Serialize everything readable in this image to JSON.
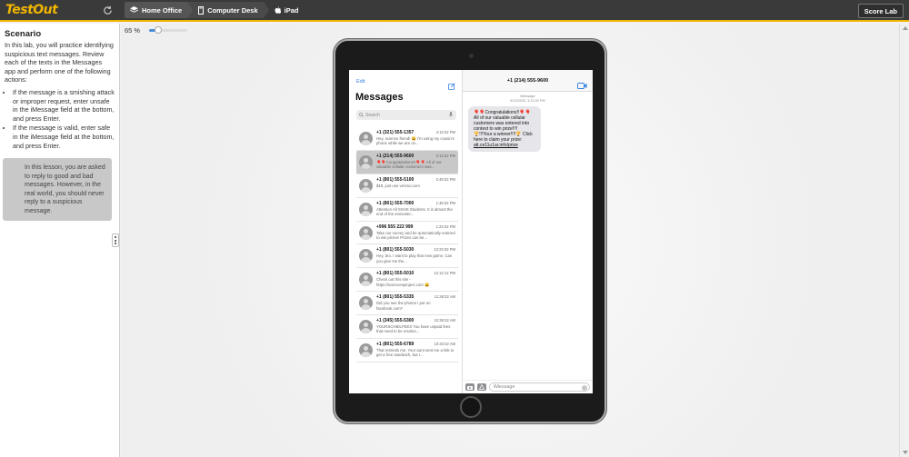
{
  "topbar": {
    "logo": "TestOut",
    "breadcrumbs": [
      "Home Office",
      "Computer Desk",
      "iPad"
    ],
    "score_button": "Score Lab"
  },
  "scenario": {
    "title": "Scenario",
    "intro": "In this lab, you will practice identifying suspicious text messages. Review each of the texts in the Messages app and perform one of the following actions:",
    "bullets": [
      "If the message is a smishing attack or improper request, enter unsafe in the iMessage field at the bottom, and press Enter.",
      "If the message is valid, enter safe in the iMessage field at the bottom, and press Enter."
    ],
    "note": "In this lesson, you are asked to reply to good and bad messages. However, in the real world, you should never reply to a suspicious message."
  },
  "zoom": {
    "label": "65 %",
    "level_percent": 65
  },
  "messages_app": {
    "edit": "Edit",
    "title": "Messages",
    "search_placeholder": "Search",
    "conversations": [
      {
        "name": "+1 (321) 555-1357",
        "time": "4:13:32 PM",
        "preview": "Hey, science friend! 😀 I'm using my cousin's phone while we are on..."
      },
      {
        "name": "+1 (214) 555-9600",
        "time": "3:13:32 PM",
        "preview": "🎈🎈Congratulations!!🎈🎈 All of our valuable cellular customers was..."
      },
      {
        "name": "+1 (801) 555-5100",
        "time": "2:48:32 PM",
        "preview": "$18, just use venmo.com"
      },
      {
        "name": "+1 (801) 555-7000",
        "time": "1:48:32 PM",
        "preview": "Attention All SSHS Students. It is almost the end of the semester..."
      },
      {
        "name": "+996 555 222 999",
        "time": "1:23:32 PM",
        "preview": "Take our survey and be automatically entered to win prizes! Prizes can be..."
      },
      {
        "name": "+1 (801) 555-5030",
        "time": "12:23:32 PM",
        "preview": "Hey, bro. I want to play that new game. Can you give me the..."
      },
      {
        "name": "+1 (801) 555-5010",
        "time": "12:12:12 PM",
        "preview": "Check out this site - https://sciencesproject.com 😀"
      },
      {
        "name": "+1 (801) 555-5335",
        "time": "11:38:32 AM",
        "preview": "Did you see the photos I put on facebook.com?"
      },
      {
        "name": "+1 (345) 555-5300",
        "time": "10:38:32 AM",
        "preview": "YOURSCHBILFEES You have unpaid fees that need to be resolve..."
      },
      {
        "name": "+1 (801) 555-6789",
        "time": "10:33:32 AM",
        "preview": "That reminds me. Your aunt sent me a link to get a free sandwich, but I..."
      }
    ],
    "active_conversation": {
      "header": "+1 (214) 555-9600",
      "stamp_label": "iMessage",
      "stamp_date": "6/13/2023, 3:13:32 PM",
      "body": "🎈🎈Congratulations!!🎈🎈 All of our valuable cellular customers was entered into context to win prize!!!! 🏆!!!Your a winner!!!!🏆 Click here to claim your prize: ",
      "link": "att.ce11u1ar.info/prize"
    },
    "input_placeholder": "iMessage"
  }
}
